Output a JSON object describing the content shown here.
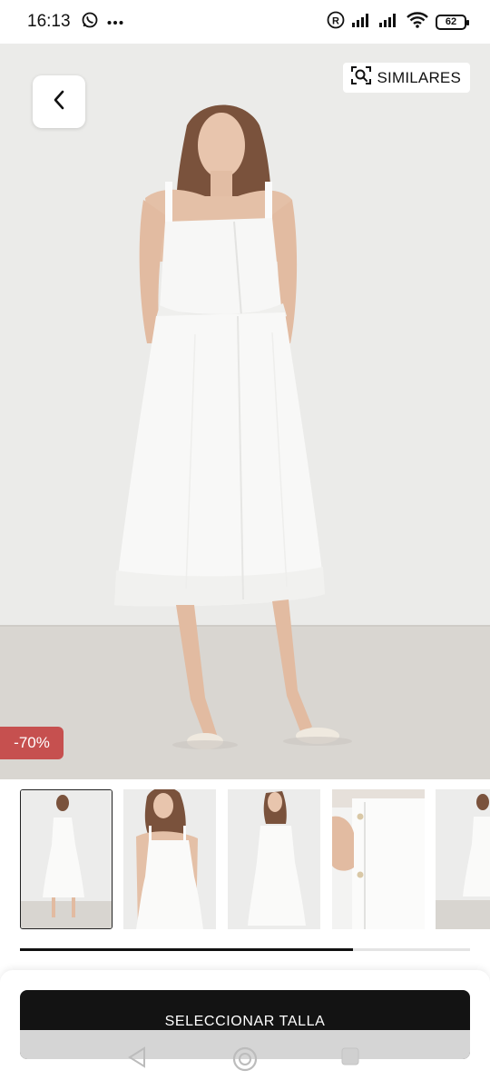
{
  "status_bar": {
    "time": "16:13",
    "battery": "62",
    "left_icons": [
      "whatsapp-icon",
      "more-dots-icon"
    ],
    "right_icons": [
      "registered-icon",
      "signal-icon",
      "signal-icon",
      "wifi-icon",
      "battery-icon"
    ]
  },
  "product": {
    "similar_label": "SIMILARES",
    "discount": "-70%",
    "thumbnails_count": 5,
    "gallery_scroll_fraction": 0.74
  },
  "cta": {
    "label": "SELECCIONAR TALLA"
  },
  "navigation": {
    "buttons": [
      "back-nav-icon",
      "home-nav-icon",
      "recents-nav-icon"
    ]
  }
}
